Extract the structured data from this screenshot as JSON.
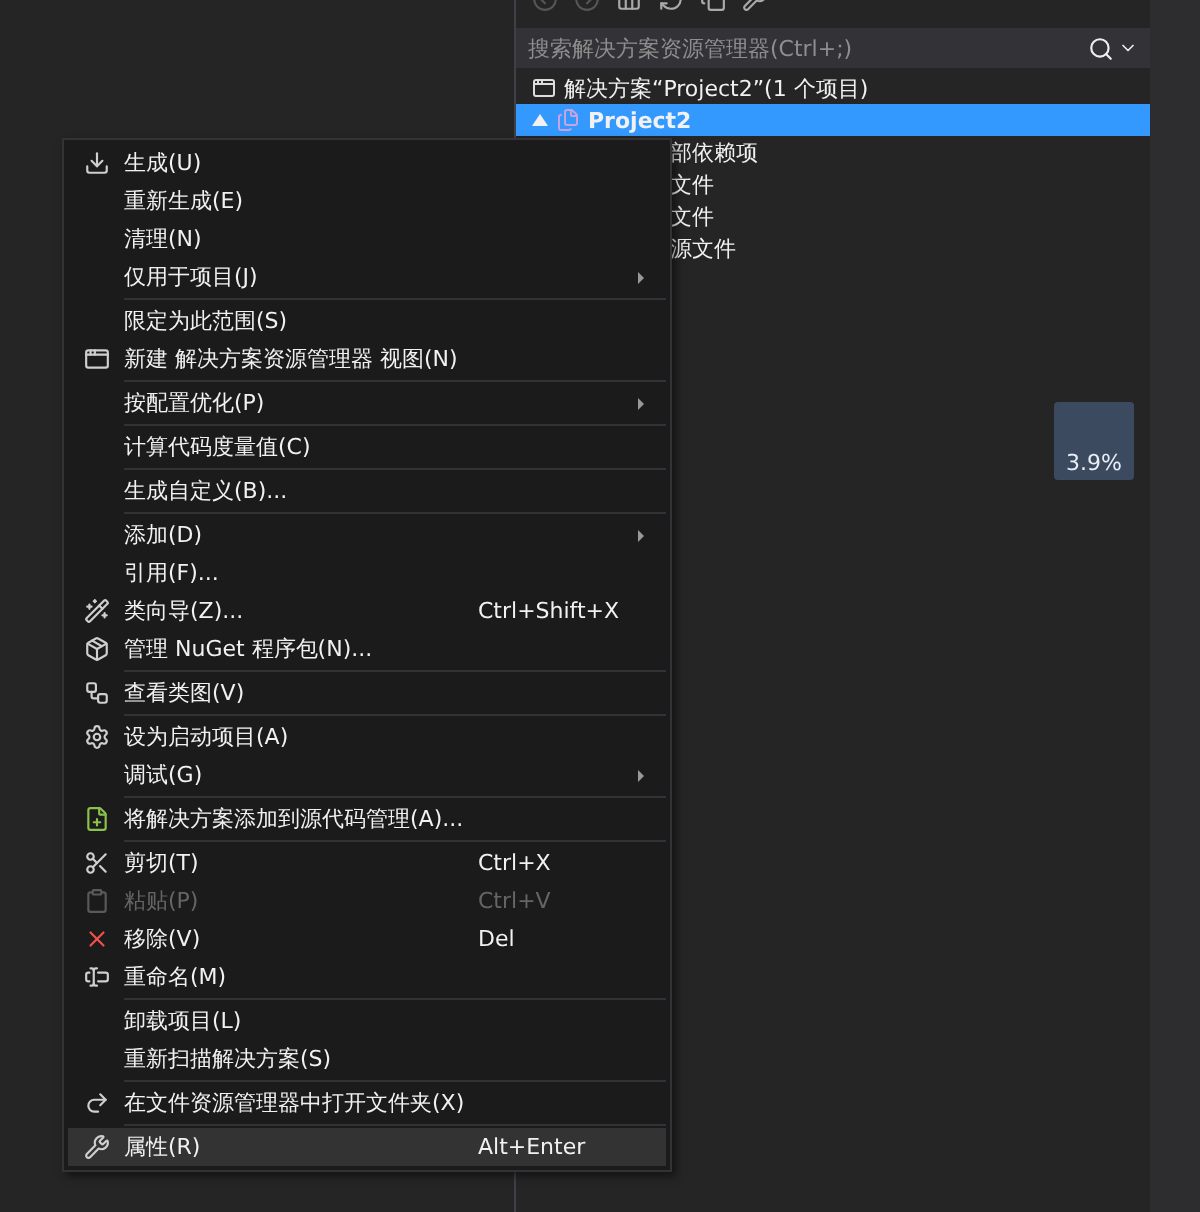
{
  "explorer": {
    "search": {
      "placeholder": "搜索解决方案资源管理器(Ctrl+;)"
    },
    "tree": [
      {
        "label": "解决方案“Project2”(1 个项目)",
        "selected": false,
        "children": [
          {
            "label": "Project2",
            "selected": true,
            "expanded": true,
            "children": [
              {
                "label": "部依赖项",
                "selected": false
              },
              {
                "label": "文件",
                "selected": false
              },
              {
                "label": "文件",
                "selected": false
              },
              {
                "label": "源文件",
                "selected": false
              }
            ]
          }
        ]
      }
    ]
  },
  "overlay_badge": {
    "text": "3.9%"
  },
  "context_menu": {
    "items": [
      {
        "kind": "item",
        "label": "生成(U)",
        "submenu": false,
        "disabled": false,
        "selected": false
      },
      {
        "kind": "item",
        "label": "重新生成(E)",
        "submenu": false,
        "disabled": false,
        "selected": false
      },
      {
        "kind": "item",
        "label": "清理(N)",
        "submenu": false,
        "disabled": false,
        "selected": false
      },
      {
        "kind": "item",
        "label": "仅用于项目(J)",
        "submenu": true,
        "disabled": false,
        "selected": false
      },
      {
        "kind": "separator"
      },
      {
        "kind": "item",
        "label": "限定为此范围(S)",
        "submenu": false,
        "disabled": false,
        "selected": false
      },
      {
        "kind": "item",
        "label": "新建 解决方案资源管理器 视图(N)",
        "submenu": false,
        "disabled": false,
        "selected": false
      },
      {
        "kind": "separator"
      },
      {
        "kind": "item",
        "label": "按配置优化(P)",
        "submenu": true,
        "disabled": false,
        "selected": false
      },
      {
        "kind": "separator"
      },
      {
        "kind": "item",
        "label": "计算代码度量值(C)",
        "submenu": false,
        "disabled": false,
        "selected": false
      },
      {
        "kind": "separator"
      },
      {
        "kind": "item",
        "label": "生成自定义(B)...",
        "submenu": false,
        "disabled": false,
        "selected": false
      },
      {
        "kind": "separator"
      },
      {
        "kind": "item",
        "label": "添加(D)",
        "submenu": true,
        "disabled": false,
        "selected": false
      },
      {
        "kind": "item",
        "label": "引用(F)...",
        "submenu": false,
        "disabled": false,
        "selected": false
      },
      {
        "kind": "item",
        "label": "类向导(Z)...",
        "shortcut": "Ctrl+Shift+X",
        "submenu": false,
        "disabled": false,
        "selected": false
      },
      {
        "kind": "item",
        "label": "管理 NuGet 程序包(N)...",
        "submenu": false,
        "disabled": false,
        "selected": false
      },
      {
        "kind": "separator"
      },
      {
        "kind": "item",
        "label": "查看类图(V)",
        "submenu": false,
        "disabled": false,
        "selected": false
      },
      {
        "kind": "separator"
      },
      {
        "kind": "item",
        "label": "设为启动项目(A)",
        "submenu": false,
        "disabled": false,
        "selected": false
      },
      {
        "kind": "item",
        "label": "调试(G)",
        "submenu": true,
        "disabled": false,
        "selected": false
      },
      {
        "kind": "separator"
      },
      {
        "kind": "item",
        "label": "将解决方案添加到源代码管理(A)...",
        "submenu": false,
        "disabled": false,
        "selected": false
      },
      {
        "kind": "separator"
      },
      {
        "kind": "item",
        "label": "剪切(T)",
        "shortcut": "Ctrl+X",
        "submenu": false,
        "disabled": false,
        "selected": false
      },
      {
        "kind": "item",
        "label": "粘贴(P)",
        "shortcut": "Ctrl+V",
        "submenu": false,
        "disabled": true,
        "selected": false
      },
      {
        "kind": "item",
        "label": "移除(V)",
        "shortcut": "Del",
        "submenu": false,
        "disabled": false,
        "selected": false
      },
      {
        "kind": "item",
        "label": "重命名(M)",
        "submenu": false,
        "disabled": false,
        "selected": false
      },
      {
        "kind": "separator"
      },
      {
        "kind": "item",
        "label": "卸载项目(L)",
        "submenu": false,
        "disabled": false,
        "selected": false
      },
      {
        "kind": "item",
        "label": "重新扫描解决方案(S)",
        "submenu": false,
        "disabled": false,
        "selected": false
      },
      {
        "kind": "separator"
      },
      {
        "kind": "item",
        "label": "在文件资源管理器中打开文件夹(X)",
        "submenu": false,
        "disabled": false,
        "selected": false
      },
      {
        "kind": "separator"
      },
      {
        "kind": "item",
        "label": "属性(R)",
        "shortcut": "Alt+Enter",
        "submenu": false,
        "disabled": false,
        "selected": true
      }
    ]
  }
}
